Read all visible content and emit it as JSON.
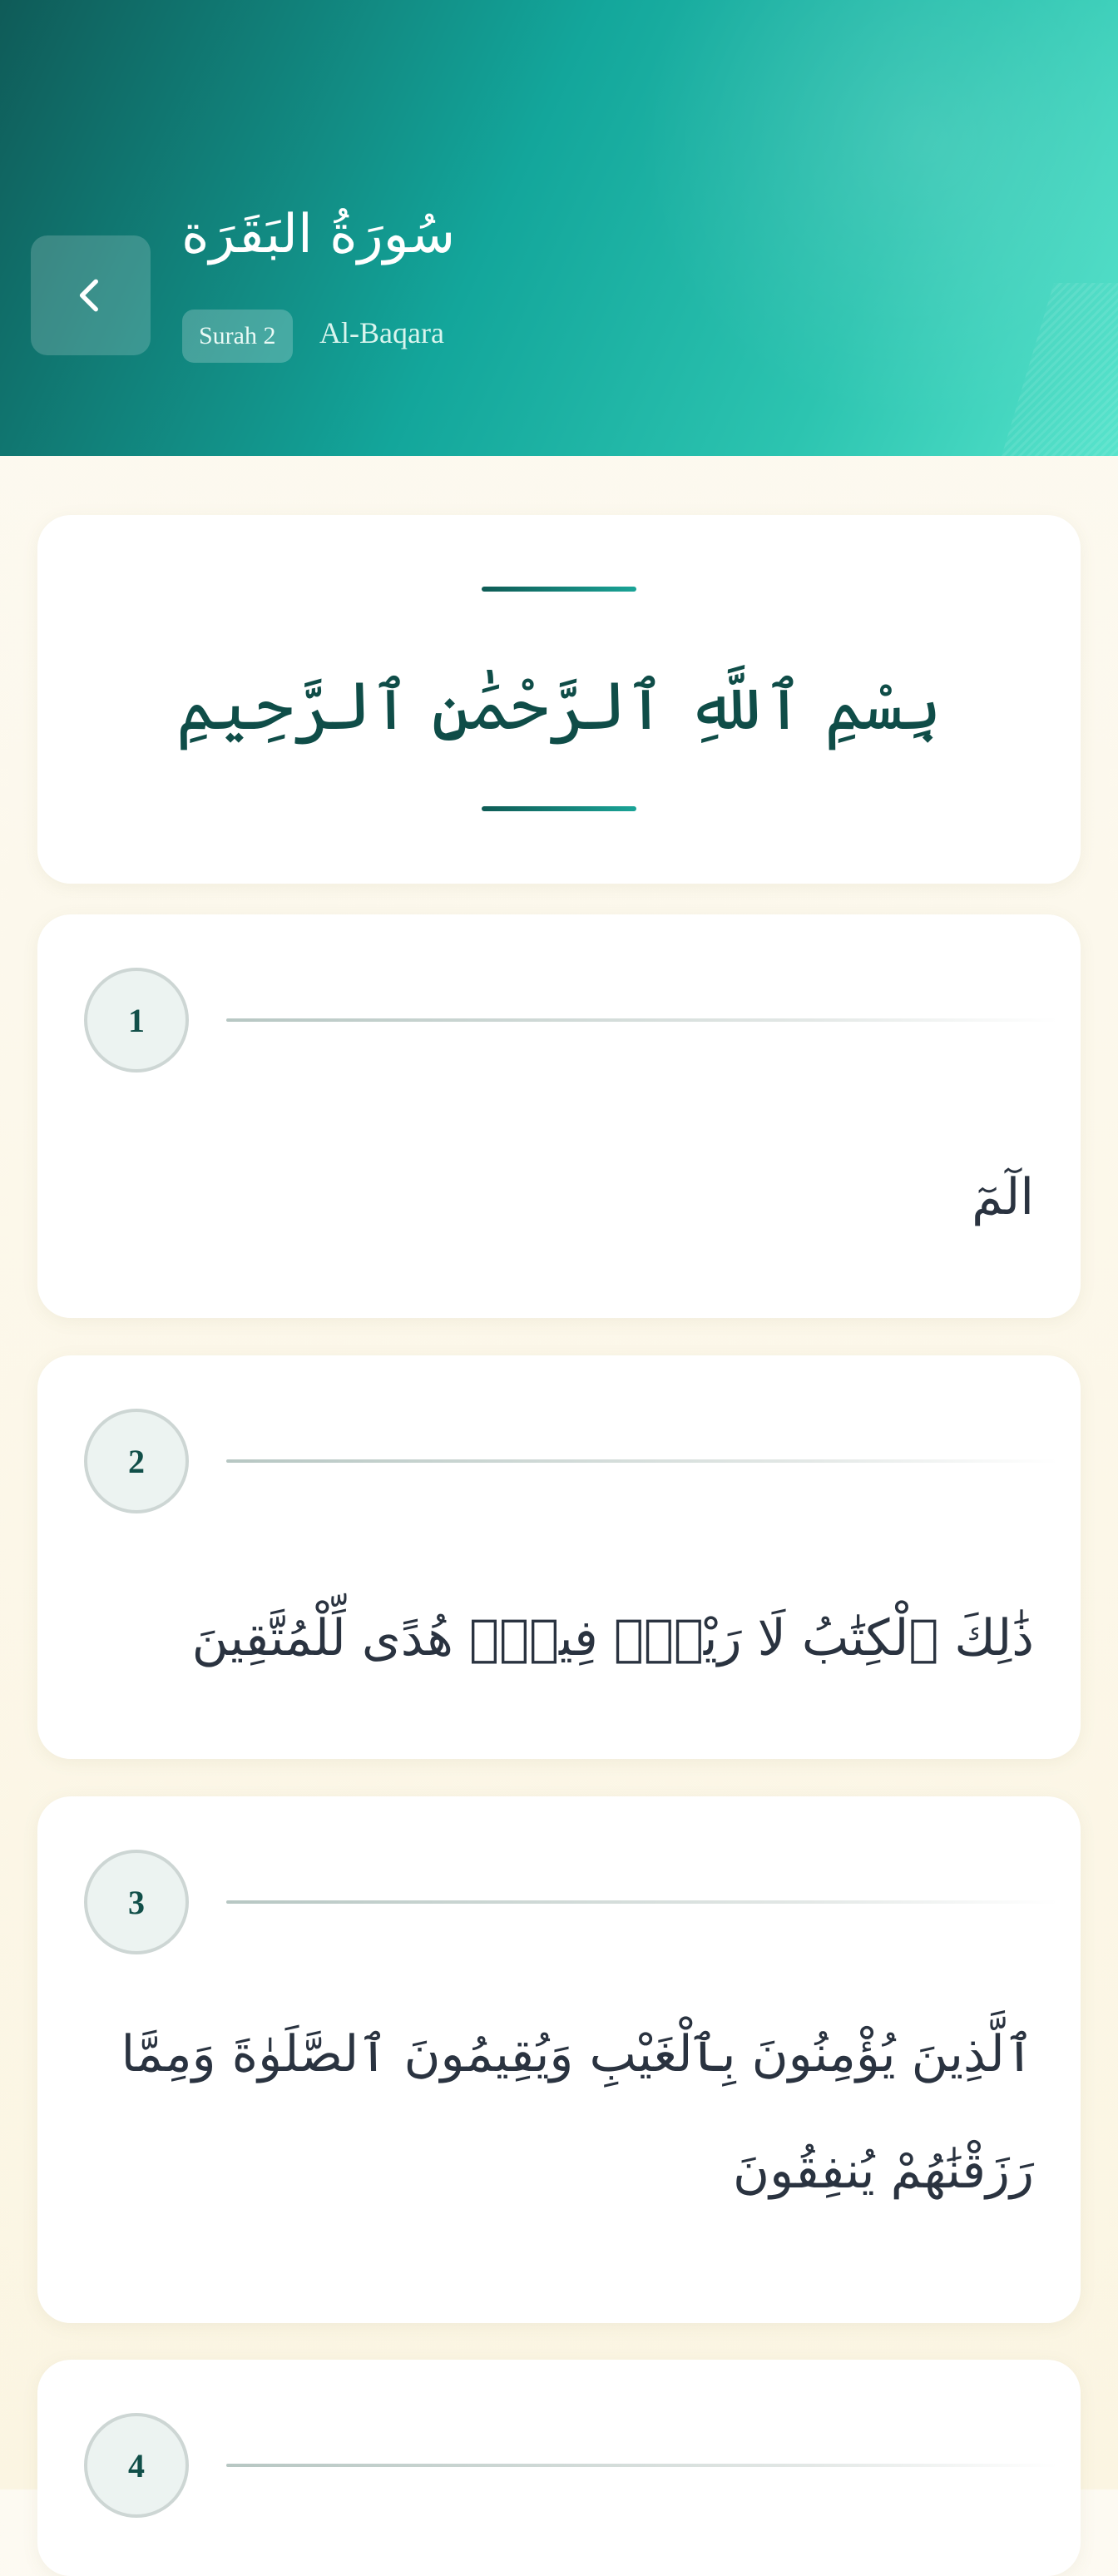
{
  "header": {
    "title_arabic": "سُورَةُ البَقَرَة",
    "surah_badge": "Surah 2",
    "surah_name": "Al-Baqara",
    "colors": {
      "gradient_start": "#0f5b58",
      "gradient_end": "#55e3cb"
    }
  },
  "bismillah": {
    "text": "بِسْمِ ٱللَّهِ ٱلرَّحْمَٰنِ ٱلرَّحِيمِ"
  },
  "verses": [
    {
      "number": "1",
      "text": "الٓمٓ"
    },
    {
      "number": "2",
      "text": "ذَٰلِكَ ٱلْكِتَٰبُ لَا رَيْبَۛ فِيهِۛ هُدًى لِّلْمُتَّقِينَ"
    },
    {
      "number": "3",
      "text": "ٱلَّذِينَ يُؤْمِنُونَ بِٱلْغَيْبِ وَيُقِيمُونَ ٱلصَّلَوٰةَ وَمِمَّا رَزَقْنَٰهُمْ يُنفِقُونَ"
    },
    {
      "number": "4",
      "text": ""
    }
  ],
  "icons": {
    "back": "chevron-left-icon"
  }
}
